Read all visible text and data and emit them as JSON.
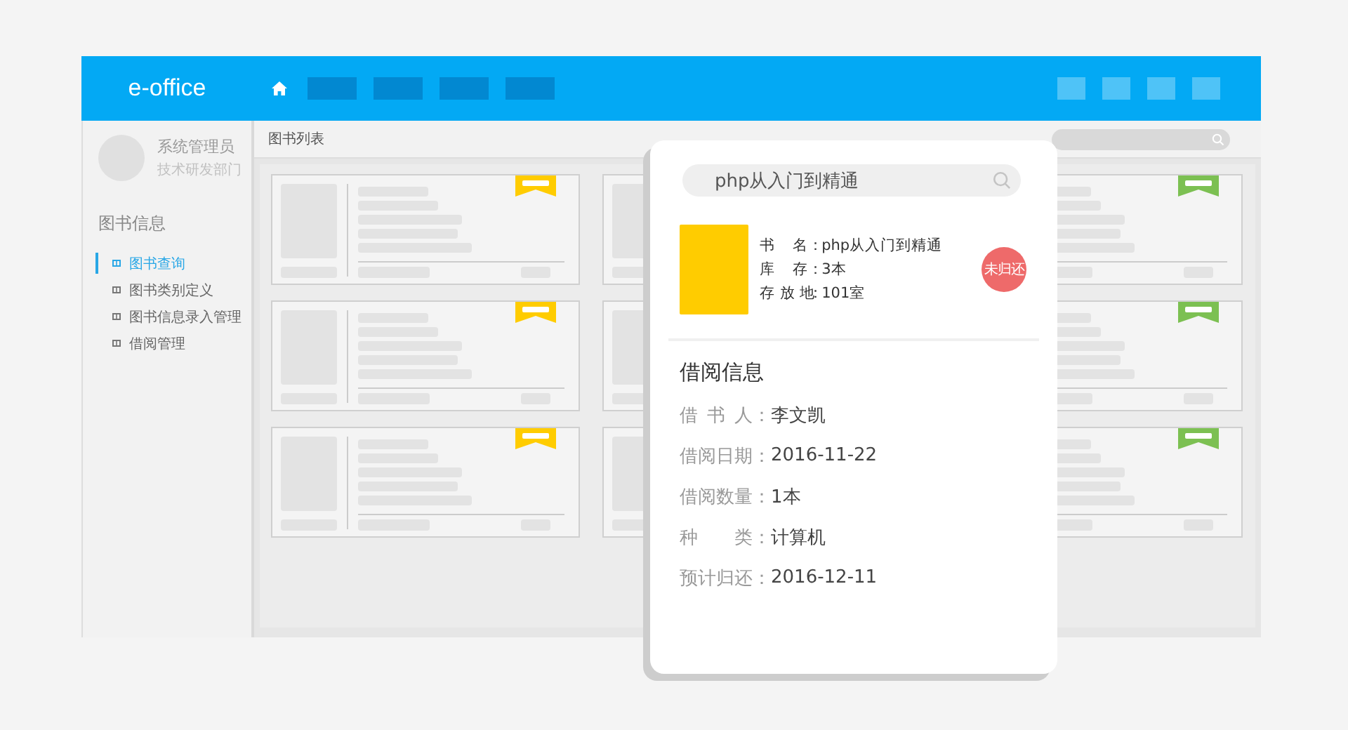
{
  "header": {
    "logo": "e-office",
    "nav_items": [
      {
        "kind": "home"
      },
      {
        "kind": "blank"
      },
      {
        "kind": "blank"
      },
      {
        "kind": "blank"
      },
      {
        "kind": "blank"
      }
    ],
    "toolbar_items": [
      {
        "kind": "blank"
      },
      {
        "kind": "blank"
      },
      {
        "kind": "blank"
      },
      {
        "kind": "blank"
      }
    ]
  },
  "sidebar": {
    "user_name": "系统管理员",
    "department": "技术研发部门",
    "section_title": "图书信息",
    "items": [
      {
        "label": "图书查询",
        "selected": true
      },
      {
        "label": "图书类别定义",
        "selected": false
      },
      {
        "label": "图书信息录入管理",
        "selected": false
      },
      {
        "label": "借阅管理",
        "selected": false
      }
    ]
  },
  "breadcrumb": "图书列表",
  "cards": [
    {
      "kind": "full",
      "color": "#ffcc00"
    },
    {
      "kind": "left_part"
    },
    {
      "kind": "right_part",
      "color": "#7cc052"
    },
    {
      "kind": "full",
      "color": "#ffcc00"
    },
    {
      "kind": "left_part"
    },
    {
      "kind": "right_part",
      "color": "#7cc052"
    },
    {
      "kind": "full",
      "color": "#ffcc00"
    },
    {
      "kind": "left_part"
    },
    {
      "kind": "right_part",
      "color": "#7cc052"
    }
  ],
  "popup": {
    "search": {
      "value": "php从入门到精通"
    },
    "book_info": [
      {
        "label": "书 名",
        "colon": "：",
        "value": "php从入门到精通"
      },
      {
        "label": "库 存",
        "colon": "：",
        "value": "3本"
      },
      {
        "label": "存 放 地",
        "colon": "：",
        "value": "101室"
      }
    ],
    "status_badge": "未归还",
    "borrow_title": "借阅信息",
    "borrow_info": [
      {
        "label": "借 书 人",
        "colon": "：",
        "value": "李文凯"
      },
      {
        "label": "借阅日期",
        "colon": "：",
        "value": "2016-11-22"
      },
      {
        "label": "借阅数量",
        "colon": "：",
        "value": "1本"
      },
      {
        "label": "种 类",
        "colon": "：",
        "value": "计算机"
      },
      {
        "label": "预计归还",
        "colon": "：",
        "value": "2016-12-11"
      }
    ]
  }
}
